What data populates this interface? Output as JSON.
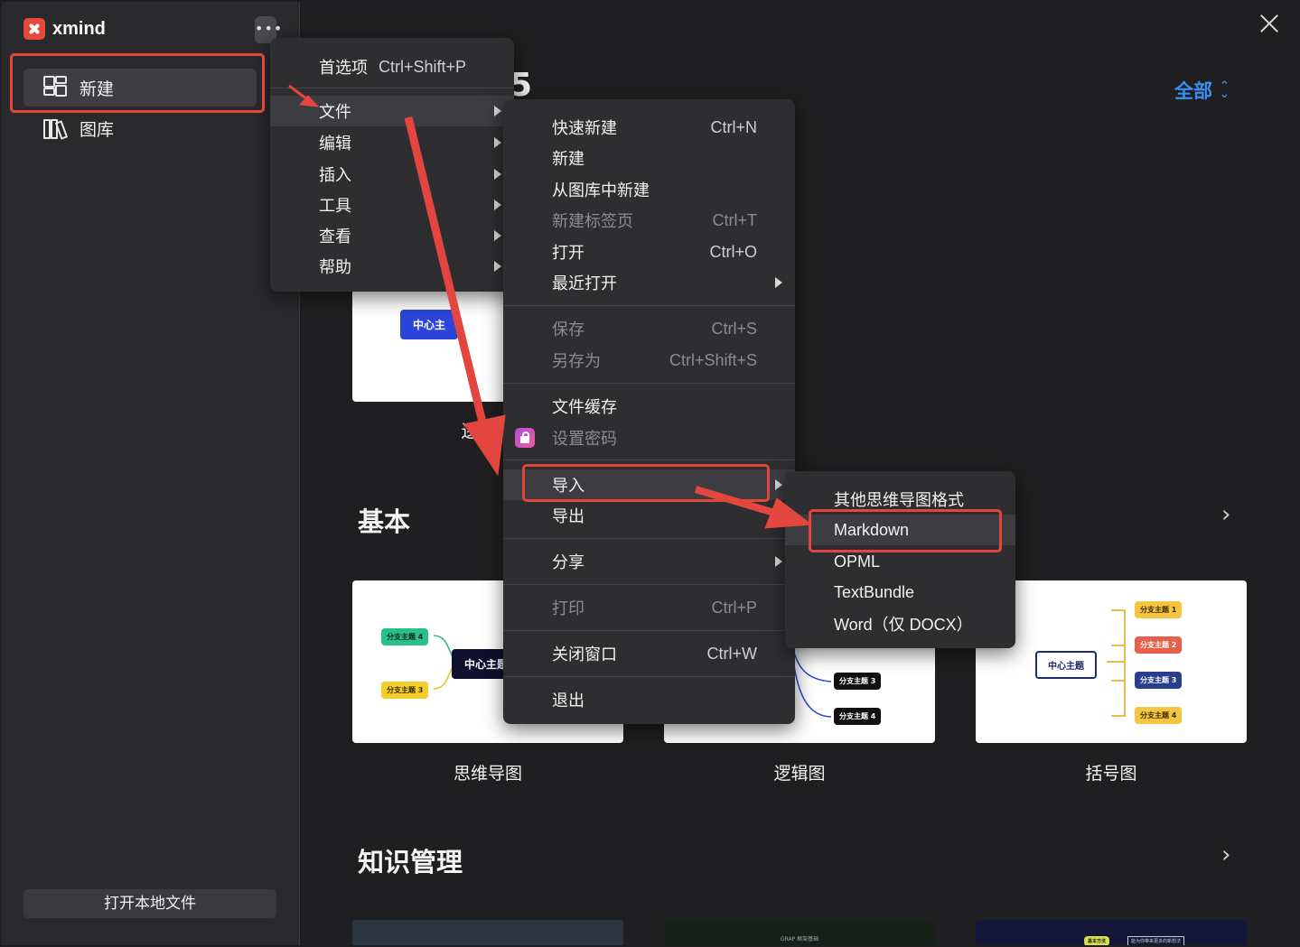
{
  "app": {
    "logo_text": "xmind",
    "more_label": "•••",
    "close_icon": "close-icon"
  },
  "sidebar": {
    "items": [
      {
        "label": "新建",
        "icon": "grid-icon",
        "active": true
      },
      {
        "label": "图库",
        "icon": "library-icon",
        "active": false
      }
    ],
    "open_local": "打开本地文件"
  },
  "main": {
    "filter_label": "全部",
    "section_basic": "基本",
    "section_knowledge": "知识管理",
    "partial_top_label": "逻",
    "partial_heading": "5",
    "cards": [
      {
        "label": "思维导图"
      },
      {
        "label": "逻辑图"
      },
      {
        "label": "括号图"
      }
    ],
    "mindmap": {
      "center": "中心主题",
      "branch_left_top": "分支主题 4",
      "branch_left_bottom": "分支主题 3"
    },
    "logic": {
      "branch3": "分支主题 3",
      "branch4": "分支主题 4"
    },
    "brace": {
      "center": "中心主题",
      "branches": [
        "分支主题 1",
        "分支主题 2",
        "分支主题 3",
        "分支主题 4"
      ]
    },
    "top_card_center": "中心主",
    "knowledge_card_text": "GRAP 框架基础",
    "knowledge_card_node": "基本方法",
    "knowledge_card_note": "能为你带来更多的新想法"
  },
  "menu1": {
    "items": [
      {
        "label": "首选项",
        "shortcut": "Ctrl+Shift+P"
      },
      {
        "label": "文件",
        "submenu": true,
        "highlighted": true
      },
      {
        "label": "编辑",
        "submenu": true
      },
      {
        "label": "插入",
        "submenu": true
      },
      {
        "label": "工具",
        "submenu": true
      },
      {
        "label": "查看",
        "submenu": true
      },
      {
        "label": "帮助",
        "submenu": true
      }
    ]
  },
  "menu2": {
    "items": [
      {
        "label": "快速新建",
        "shortcut": "Ctrl+N"
      },
      {
        "label": "新建"
      },
      {
        "label": "从图库中新建"
      },
      {
        "label": "新建标签页",
        "shortcut": "Ctrl+T",
        "disabled": true
      },
      {
        "label": "打开",
        "shortcut": "Ctrl+O"
      },
      {
        "label": "最近打开",
        "submenu": true
      },
      {
        "label": "保存",
        "shortcut": "Ctrl+S",
        "disabled": true
      },
      {
        "label": "另存为",
        "shortcut": "Ctrl+Shift+S",
        "disabled": true
      },
      {
        "label": "文件缓存"
      },
      {
        "label": "设置密码",
        "disabled": true,
        "icon": "lock-icon"
      },
      {
        "label": "导入",
        "submenu": true,
        "highlighted": true
      },
      {
        "label": "导出",
        "submenu": true
      },
      {
        "label": "分享",
        "submenu": true
      },
      {
        "label": "打印",
        "shortcut": "Ctrl+P",
        "disabled": true
      },
      {
        "label": "关闭窗口",
        "shortcut": "Ctrl+W"
      },
      {
        "label": "退出"
      }
    ]
  },
  "menu3": {
    "items": [
      {
        "label": "其他思维导图格式"
      },
      {
        "label": "Markdown",
        "highlighted": true
      },
      {
        "label": "OPML"
      },
      {
        "label": "TextBundle"
      },
      {
        "label": "Word（仅 DOCX）"
      }
    ]
  },
  "colors": {
    "accent": "#3a8ff5",
    "annotation_red": "#e5453f",
    "menu_bg": "#2e2e31",
    "sidebar_bg": "#2a2a2d"
  }
}
